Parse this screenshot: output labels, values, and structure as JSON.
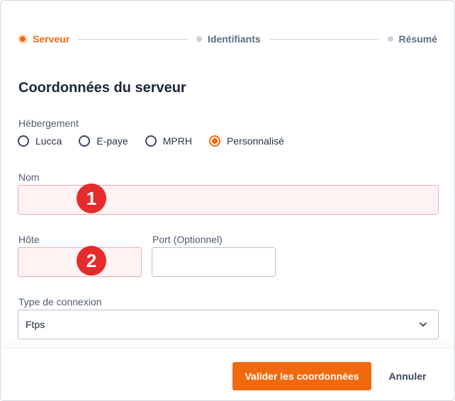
{
  "stepper": {
    "steps": [
      {
        "label": "Serveur",
        "state": "active"
      },
      {
        "label": "Identifiants",
        "state": "pending"
      },
      {
        "label": "Résumé",
        "state": "pending"
      }
    ]
  },
  "section_title": "Coordonnées du serveur",
  "hosting": {
    "label": "Hébergement",
    "options": [
      "Lucca",
      "E-paye",
      "MPRH",
      "Personnalisé"
    ],
    "selected": "Personnalisé"
  },
  "fields": {
    "name": {
      "label": "Nom",
      "value": "",
      "badge": "1"
    },
    "host": {
      "label": "Hôte",
      "value": "",
      "badge": "2"
    },
    "port": {
      "label": "Port (Optionnel)",
      "value": ""
    }
  },
  "connection_type": {
    "label": "Type de connexion",
    "value": "Ftps",
    "icon": "chevron-down-icon"
  },
  "footer": {
    "submit_label": "Valider les coordonnées",
    "cancel_label": "Annuler"
  },
  "colors": {
    "accent": "#f0690f",
    "error_bg": "#fff2f3",
    "error_border": "#f1a7b0",
    "badge": "#e52b2b"
  }
}
